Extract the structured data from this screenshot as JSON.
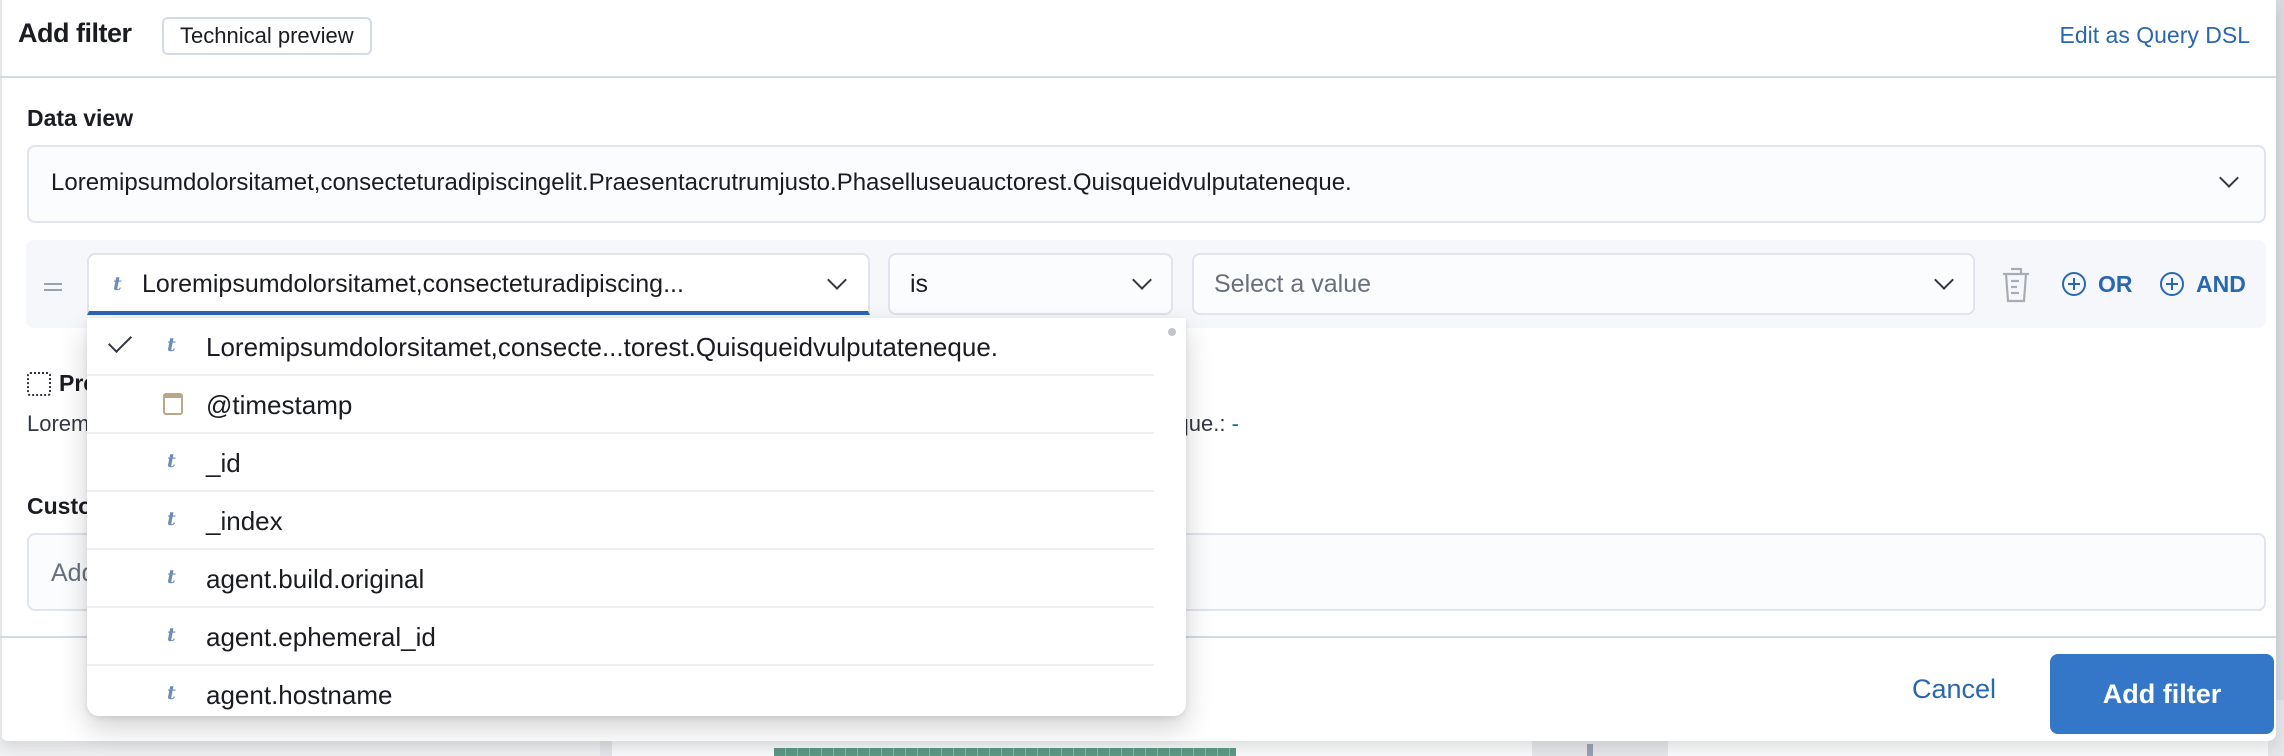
{
  "header": {
    "title": "Add filter",
    "badge": "Technical preview",
    "edit_dsl_link": "Edit as Query DSL"
  },
  "data_view": {
    "label": "Data view",
    "value": "Loremipsumdolorsitamet,consecteturadipiscingelit.Praesentacrutrumjusto.Phasellusеuauctorest.Quisqueidvulputateneque."
  },
  "filter_row": {
    "field": {
      "type_icon": "t",
      "value": "Loremipsumdolorsitamet,consecteturadipiscing..."
    },
    "operator": {
      "value": "is"
    },
    "value_select": {
      "placeholder": "Select a value"
    },
    "or_label": "OR",
    "and_label": "AND"
  },
  "field_dropdown": {
    "items": [
      {
        "type": "string",
        "type_icon": "t",
        "label": "Loremipsumdolorsitamet,consecte...torest.Quisqueidvulputateneque.",
        "selected": true
      },
      {
        "type": "date",
        "type_icon": "calendar",
        "label": "@timestamp",
        "selected": false
      },
      {
        "type": "string",
        "type_icon": "t",
        "label": "_id",
        "selected": false
      },
      {
        "type": "string",
        "type_icon": "t",
        "label": "_index",
        "selected": false
      },
      {
        "type": "string",
        "type_icon": "t",
        "label": "agent.build.original",
        "selected": false
      },
      {
        "type": "string",
        "type_icon": "t",
        "label": "agent.ephemeral_id",
        "selected": false
      },
      {
        "type": "string",
        "type_icon": "t",
        "label": "agent.hostname",
        "selected": false
      }
    ]
  },
  "preview": {
    "title": "Preview",
    "text": "Loremipsumdolorsitamet,consecteturadipiscingelit.Praesentacrutrumjusto.Phasellusеuauctorest.Quisqueidvulputateneque.:",
    "value": "-"
  },
  "custom_label": {
    "label": "Custom label",
    "placeholder": "Add a custom label here"
  },
  "footer": {
    "cancel": "Cancel",
    "submit": "Add filter"
  },
  "colors": {
    "primary": "#3476c7",
    "link": "#2a67b1",
    "success_dash": "#017d73"
  }
}
